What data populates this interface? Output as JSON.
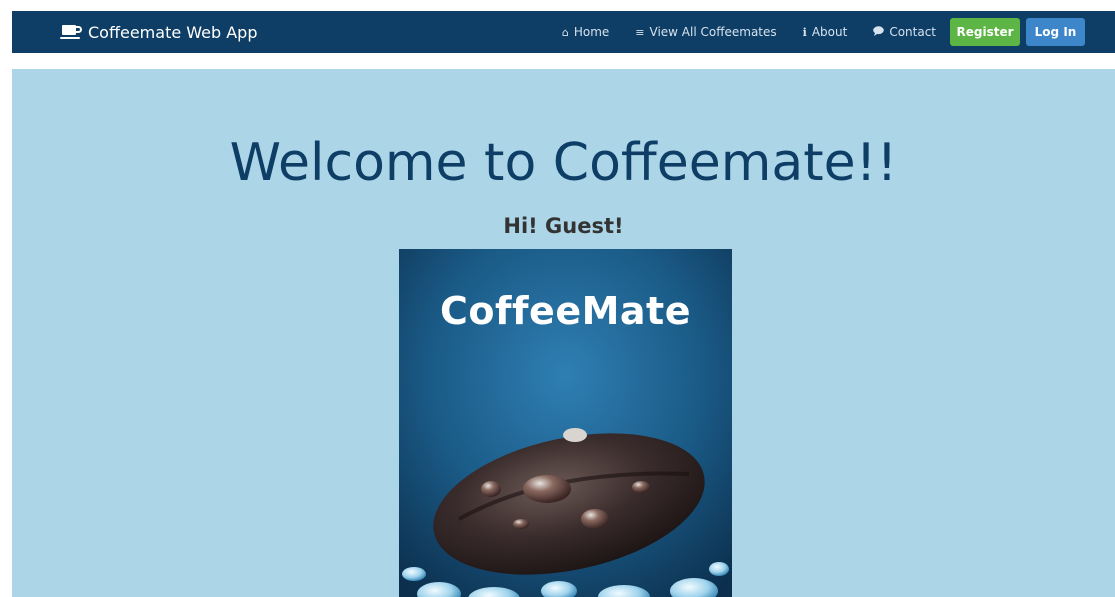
{
  "navbar": {
    "brand": {
      "label": "Coffeemate Web App",
      "icon": "coffee-cup-icon"
    },
    "links": [
      {
        "label": "Home",
        "icon": "home-icon"
      },
      {
        "label": "View All Coffeemates",
        "icon": "list-icon"
      },
      {
        "label": "About",
        "icon": "info-icon"
      },
      {
        "label": "Contact",
        "icon": "comment-icon"
      }
    ],
    "register_label": "Register",
    "login_label": "Log In"
  },
  "hero": {
    "title": "Welcome to Coffeemate!!",
    "greeting": "Hi! Guest!",
    "image": {
      "caption": "CoffeeMate"
    }
  },
  "colors": {
    "navbar_bg": "#0e3e66",
    "hero_bg": "#acd6e7",
    "title_color": "#0e3e66",
    "register_bg": "#5cb544",
    "login_bg": "#3c86c9"
  }
}
